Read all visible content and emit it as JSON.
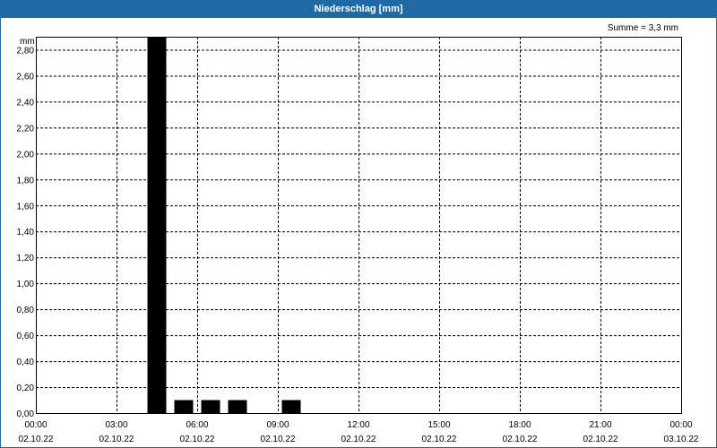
{
  "window": {
    "title": "Niederschlag [mm]"
  },
  "summary": "Summe = 3,3 mm",
  "colors": {
    "titlebar": "#1f6aa5",
    "bar": "#000000",
    "grid": "#000000"
  },
  "chart_data": {
    "type": "bar",
    "unit": "mm",
    "ylim": [
      0,
      2.9
    ],
    "y_ticks": [
      "0,00",
      "0,20",
      "0,40",
      "0,60",
      "0,80",
      "1,00",
      "1,20",
      "1,40",
      "1,60",
      "1,80",
      "2,00",
      "2,20",
      "2,40",
      "2,60",
      "2,80"
    ],
    "x_ticks": [
      {
        "time": "00:00",
        "date": "02.10.22"
      },
      {
        "time": "03:00",
        "date": "02.10.22"
      },
      {
        "time": "06:00",
        "date": "02.10.22"
      },
      {
        "time": "09:00",
        "date": "02.10.22"
      },
      {
        "time": "12:00",
        "date": "02.10.22"
      },
      {
        "time": "15:00",
        "date": "02.10.22"
      },
      {
        "time": "18:00",
        "date": "02.10.22"
      },
      {
        "time": "21:00",
        "date": "02.10.22"
      },
      {
        "time": "00:00",
        "date": "03.10.22"
      }
    ],
    "grid": true,
    "bars": [
      {
        "start": "04:00",
        "end": "05:00",
        "value": 2.9
      },
      {
        "start": "05:00",
        "end": "06:00",
        "value": 0.1
      },
      {
        "start": "06:00",
        "end": "07:00",
        "value": 0.1
      },
      {
        "start": "07:00",
        "end": "08:00",
        "value": 0.1
      },
      {
        "start": "09:00",
        "end": "10:00",
        "value": 0.1
      }
    ]
  }
}
